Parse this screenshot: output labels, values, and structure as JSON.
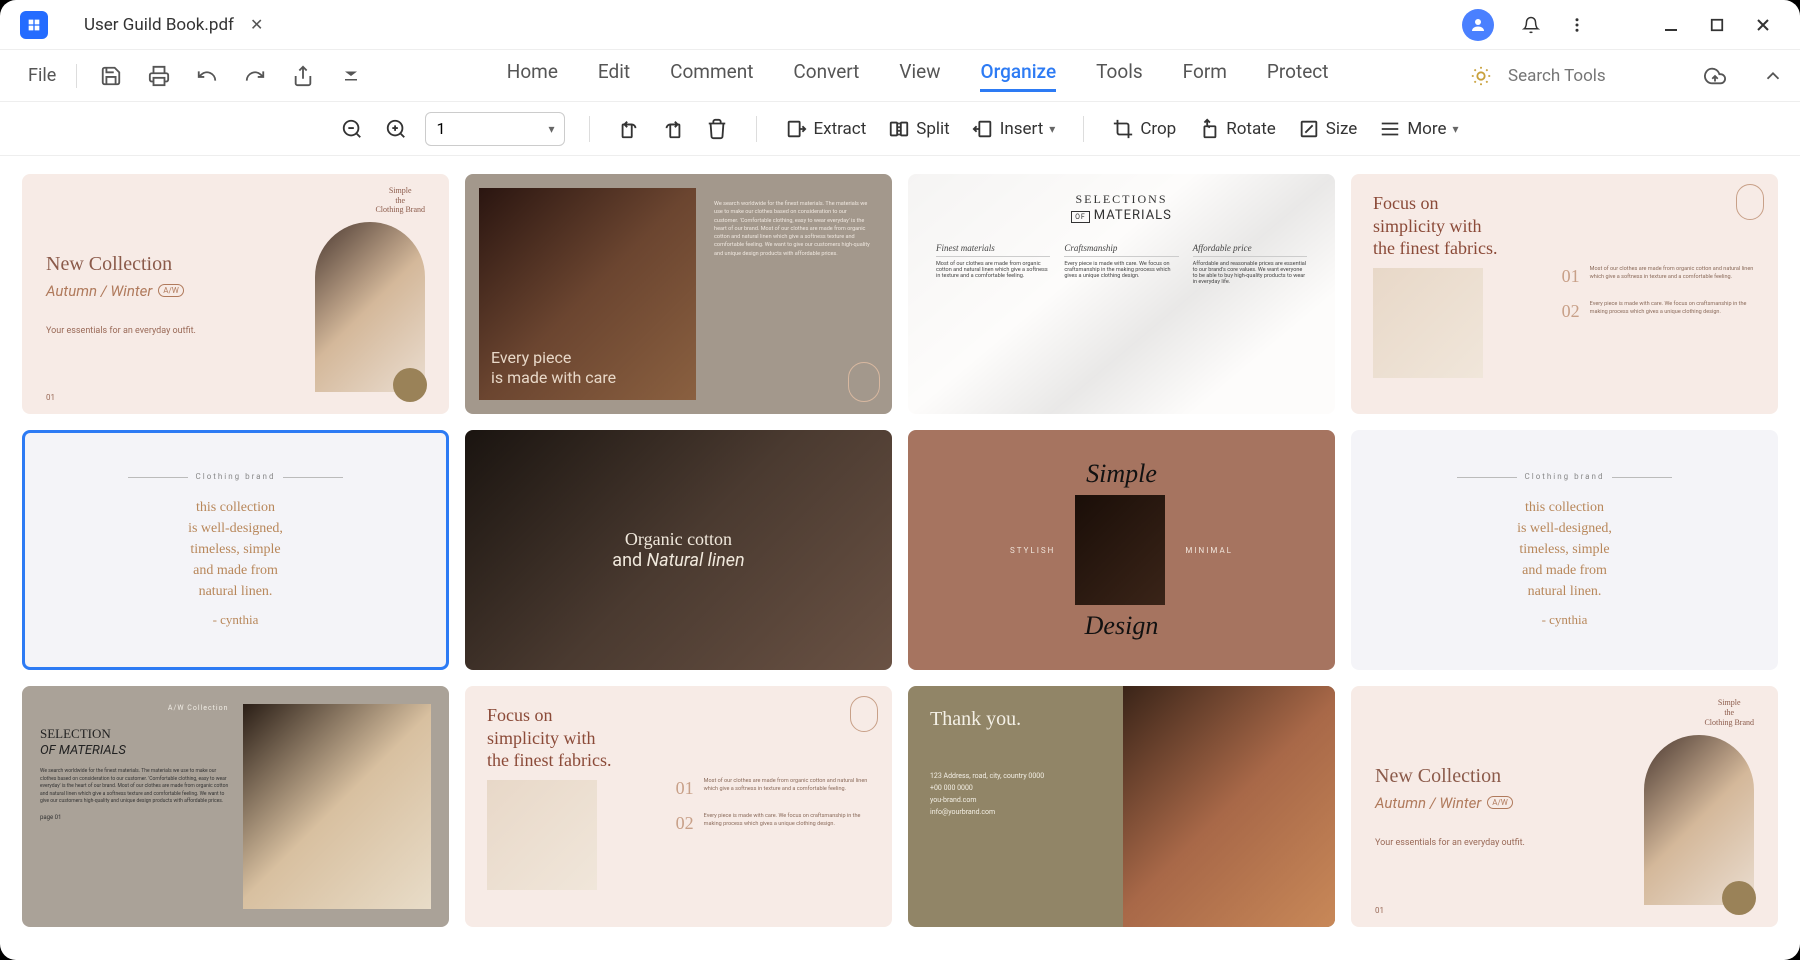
{
  "titlebar": {
    "tab_name": "User Guild Book.pdf"
  },
  "menubar": {
    "file": "File",
    "tabs": [
      "Home",
      "Edit",
      "Comment",
      "Convert",
      "View",
      "Organize",
      "Tools",
      "Form",
      "Protect"
    ],
    "active_index": 5,
    "search_placeholder": "Search Tools"
  },
  "toolbar": {
    "page_value": "1",
    "extract": "Extract",
    "split": "Split",
    "insert": "Insert",
    "crop": "Crop",
    "rotate": "Rotate",
    "size": "Size",
    "more": "More"
  },
  "thumbs": {
    "selected_index": 4,
    "t1": {
      "title": "New Collection",
      "subtitle": "Autumn / Winter",
      "badge": "A/W",
      "tagline": "Your essentials for an everyday outfit.",
      "page": "01",
      "brand": "Simple\nthe\nClothing Brand"
    },
    "t2": {
      "overlay_line1": "Every piece",
      "overlay_line2": "is made with care",
      "copy": "We search worldwide for the finest materials. The materials we use to make our clothes based on consideration to our customer. 'Comfortable clothing, easy to wear everyday' is the heart of our brand. Most of our clothes are made from organic cotton and natural linen which give a softness texture and comfortable feeling. We want to give our customers high-quality and unique design products with affordable prices."
    },
    "t3": {
      "heading1": "SELECTIONS",
      "heading2": "MATERIALS",
      "of": "OF",
      "col1_h": "Finest materials",
      "col1_t": "Most of our clothes are made from organic cotton and natural linen which give a softness in texture and a comfortable feeling.",
      "col2_h": "Craftsmanship",
      "col2_t": "Every piece is made with care. We focus on craftsmanship in the making process which gives a unique clothing design.",
      "col3_h": "Affordable price",
      "col3_t": "Affordable and reasonable prices are essential to our brand's core values. We want everyone to be able to buy high-quality products to wear in everyday life."
    },
    "t4": {
      "title": "Focus on\nsimplicity with\nthe finest fabrics.",
      "n1": "01",
      "txt1": "Most of our clothes are made from organic cotton and natural linen which give a softness in texture and a comfortable feeling.",
      "n2": "02",
      "txt2": "Every piece is made with care. We focus on craftsmanship in the making process which gives a unique clothing design."
    },
    "t5": {
      "bar": "Clothing brand",
      "script": "this collection\nis well-designed,\ntimeless, simple\nand made from\nnatural linen.",
      "sig": "- cynthia"
    },
    "t6": {
      "line1": "Organic cotton",
      "line2_a": "and ",
      "line2_b": "Natural linen"
    },
    "t7": {
      "top": "Simple",
      "left": "STYLISH",
      "right": "MINIMAL",
      "bottom": "Design"
    },
    "t9": {
      "brand": "A/W Collection",
      "h1": "SELECTION",
      "h2_a": "OF ",
      "h2_b": "MATERIALS",
      "body": "We search worldwide for the finest materials. The materials we use to make our clothes based on consideration to our customer. 'Comfortable clothing, easy to wear everyday' is the heart of our brand. Most of our clothes are made from organic cotton and natural linen which give a softness texture and comfortable feeling. We want to give our customers high-quality and unique design products with affordable prices.",
      "page": "page 01"
    },
    "t11": {
      "thanks": "Thank you.",
      "addr": "123 Address, road, city, country 0000\n+00 000 0000\nyou-brand.com\ninfo@yourbrand.com"
    }
  }
}
